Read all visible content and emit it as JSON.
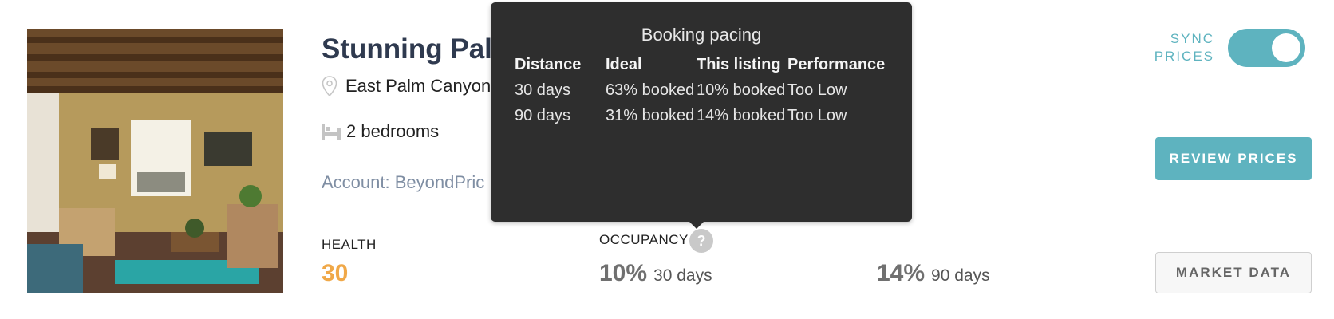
{
  "listing": {
    "title": "Stunning Palm",
    "location": "East Palm Canyon",
    "bedrooms": "2 bedrooms",
    "account": "Account: BeyondPric",
    "icons": {
      "location": "map-pin-icon",
      "bedrooms": "bed-icon",
      "help": "question-icon"
    }
  },
  "health": {
    "label": "HEALTH",
    "value": "30",
    "color": "#f0a848"
  },
  "occupancy": {
    "label": "OCCUPANCY",
    "help_glyph": "?",
    "stats": [
      {
        "value": "10%",
        "period": "30 days"
      },
      {
        "value": "14%",
        "period": "90 days"
      }
    ]
  },
  "tooltip": {
    "title": "Booking pacing",
    "headers": [
      "Distance",
      "Ideal",
      "This listing",
      "Performance"
    ],
    "rows": [
      [
        "30 days",
        "63% booked",
        "10% booked",
        "Too Low"
      ],
      [
        "90 days",
        "31% booked",
        "14% booked",
        "Too Low"
      ]
    ]
  },
  "controls": {
    "sync_label": "SYNC PRICES",
    "sync_on": true,
    "review_button": "REVIEW PRICES",
    "market_button": "MARKET DATA",
    "accent_color": "#5eb3bf"
  }
}
